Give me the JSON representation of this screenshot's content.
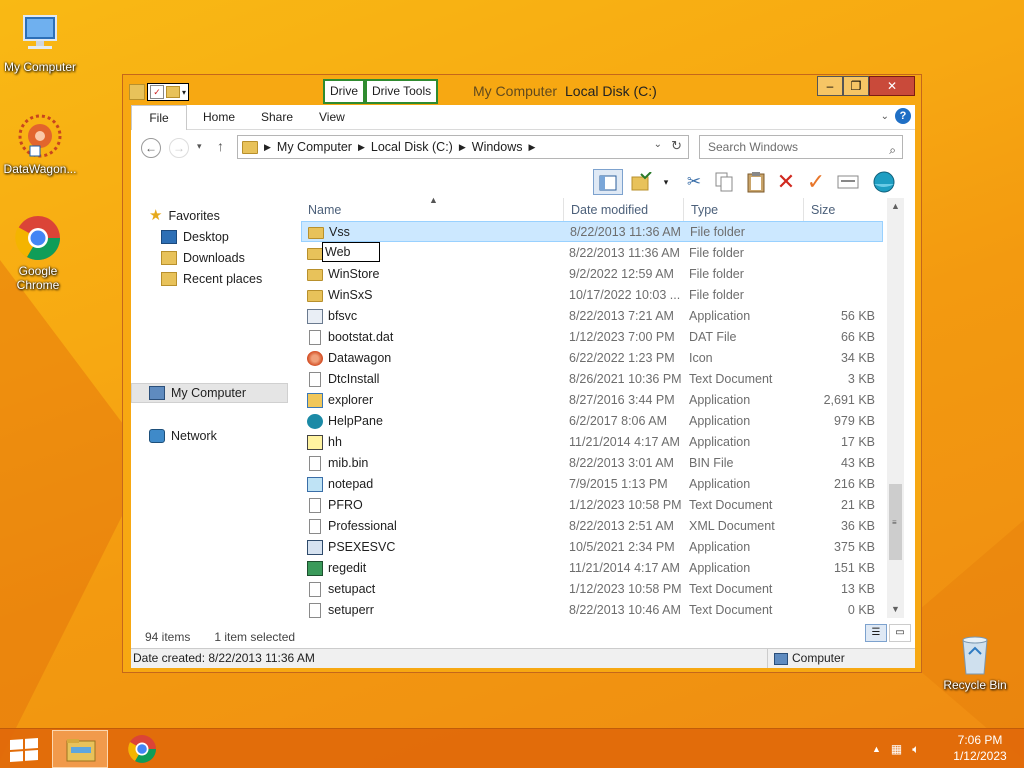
{
  "desktop": {
    "icons": [
      {
        "label": "My Computer"
      },
      {
        "label": "DataWagon..."
      },
      {
        "label": "Google Chrome"
      },
      {
        "label": "Recycle Bin"
      }
    ]
  },
  "window": {
    "title": "Local Disk (C:)",
    "title_overlap": "My Computer",
    "context_tabs": [
      "Drive",
      "Drive Tools"
    ],
    "ribbon_tabs": [
      "File",
      "Home",
      "Share",
      "View"
    ],
    "controls": {
      "minimize": "‒",
      "maximize": "❐",
      "close": "✕"
    }
  },
  "address": {
    "segments": [
      "My Computer",
      "Local Disk (C:)",
      "Windows"
    ],
    "search_placeholder": "Search Windows"
  },
  "nav": {
    "favorites": "Favorites",
    "desktop": "Desktop",
    "downloads": "Downloads",
    "recent": "Recent places",
    "computer": "My Computer",
    "network": "Network"
  },
  "columns": {
    "name": "Name",
    "date": "Date modified",
    "type": "Type",
    "size": "Size"
  },
  "files": [
    {
      "name": "Vss",
      "date": "8/22/2013 11:36 AM",
      "type": "File folder",
      "size": "",
      "icon": "folder",
      "selected": true
    },
    {
      "name": "Web",
      "date": "8/22/2013 11:36 AM",
      "type": "File folder",
      "size": "",
      "icon": "folder",
      "renaming": true
    },
    {
      "name": "WinStore",
      "date": "9/2/2022 12:59 AM",
      "type": "File folder",
      "size": "",
      "icon": "folder"
    },
    {
      "name": "WinSxS",
      "date": "10/17/2022 10:03 ...",
      "type": "File folder",
      "size": "",
      "icon": "folder"
    },
    {
      "name": "bfsvc",
      "date": "8/22/2013 7:21 AM",
      "type": "Application",
      "size": "56 KB",
      "icon": "app"
    },
    {
      "name": "bootstat.dat",
      "date": "1/12/2023 7:00 PM",
      "type": "DAT File",
      "size": "66 KB",
      "icon": "doc"
    },
    {
      "name": "Datawagon",
      "date": "6/22/2022 1:23 PM",
      "type": "Icon",
      "size": "34 KB",
      "icon": "dw"
    },
    {
      "name": "DtcInstall",
      "date": "8/26/2021 10:36 PM",
      "type": "Text Document",
      "size": "3 KB",
      "icon": "doc"
    },
    {
      "name": "explorer",
      "date": "8/27/2016 3:44 PM",
      "type": "Application",
      "size": "2,691 KB",
      "icon": "explorer"
    },
    {
      "name": "HelpPane",
      "date": "6/2/2017 8:06 AM",
      "type": "Application",
      "size": "979 KB",
      "icon": "help"
    },
    {
      "name": "hh",
      "date": "11/21/2014 4:17 AM",
      "type": "Application",
      "size": "17 KB",
      "icon": "hh"
    },
    {
      "name": "mib.bin",
      "date": "8/22/2013 3:01 AM",
      "type": "BIN File",
      "size": "43 KB",
      "icon": "doc"
    },
    {
      "name": "notepad",
      "date": "7/9/2015 1:13 PM",
      "type": "Application",
      "size": "216 KB",
      "icon": "note"
    },
    {
      "name": "PFRO",
      "date": "1/12/2023 10:58 PM",
      "type": "Text Document",
      "size": "21 KB",
      "icon": "doc"
    },
    {
      "name": "Professional",
      "date": "8/22/2013 2:51 AM",
      "type": "XML Document",
      "size": "36 KB",
      "icon": "doc"
    },
    {
      "name": "PSEXESVC",
      "date": "10/5/2021 2:34 PM",
      "type": "Application",
      "size": "375 KB",
      "icon": "ps"
    },
    {
      "name": "regedit",
      "date": "11/21/2014 4:17 AM",
      "type": "Application",
      "size": "151 KB",
      "icon": "reg"
    },
    {
      "name": "setupact",
      "date": "1/12/2023 10:58 PM",
      "type": "Text Document",
      "size": "13 KB",
      "icon": "doc"
    },
    {
      "name": "setuperr",
      "date": "8/22/2013 10:46 AM",
      "type": "Text Document",
      "size": "0 KB",
      "icon": "doc"
    }
  ],
  "status": {
    "item_count": "94 items",
    "selected": "1 item selected",
    "date_created": "Date created: 8/22/2013 11:36 AM",
    "location": "Computer"
  },
  "taskbar": {
    "time": "7:06 PM",
    "date": "1/12/2023"
  }
}
